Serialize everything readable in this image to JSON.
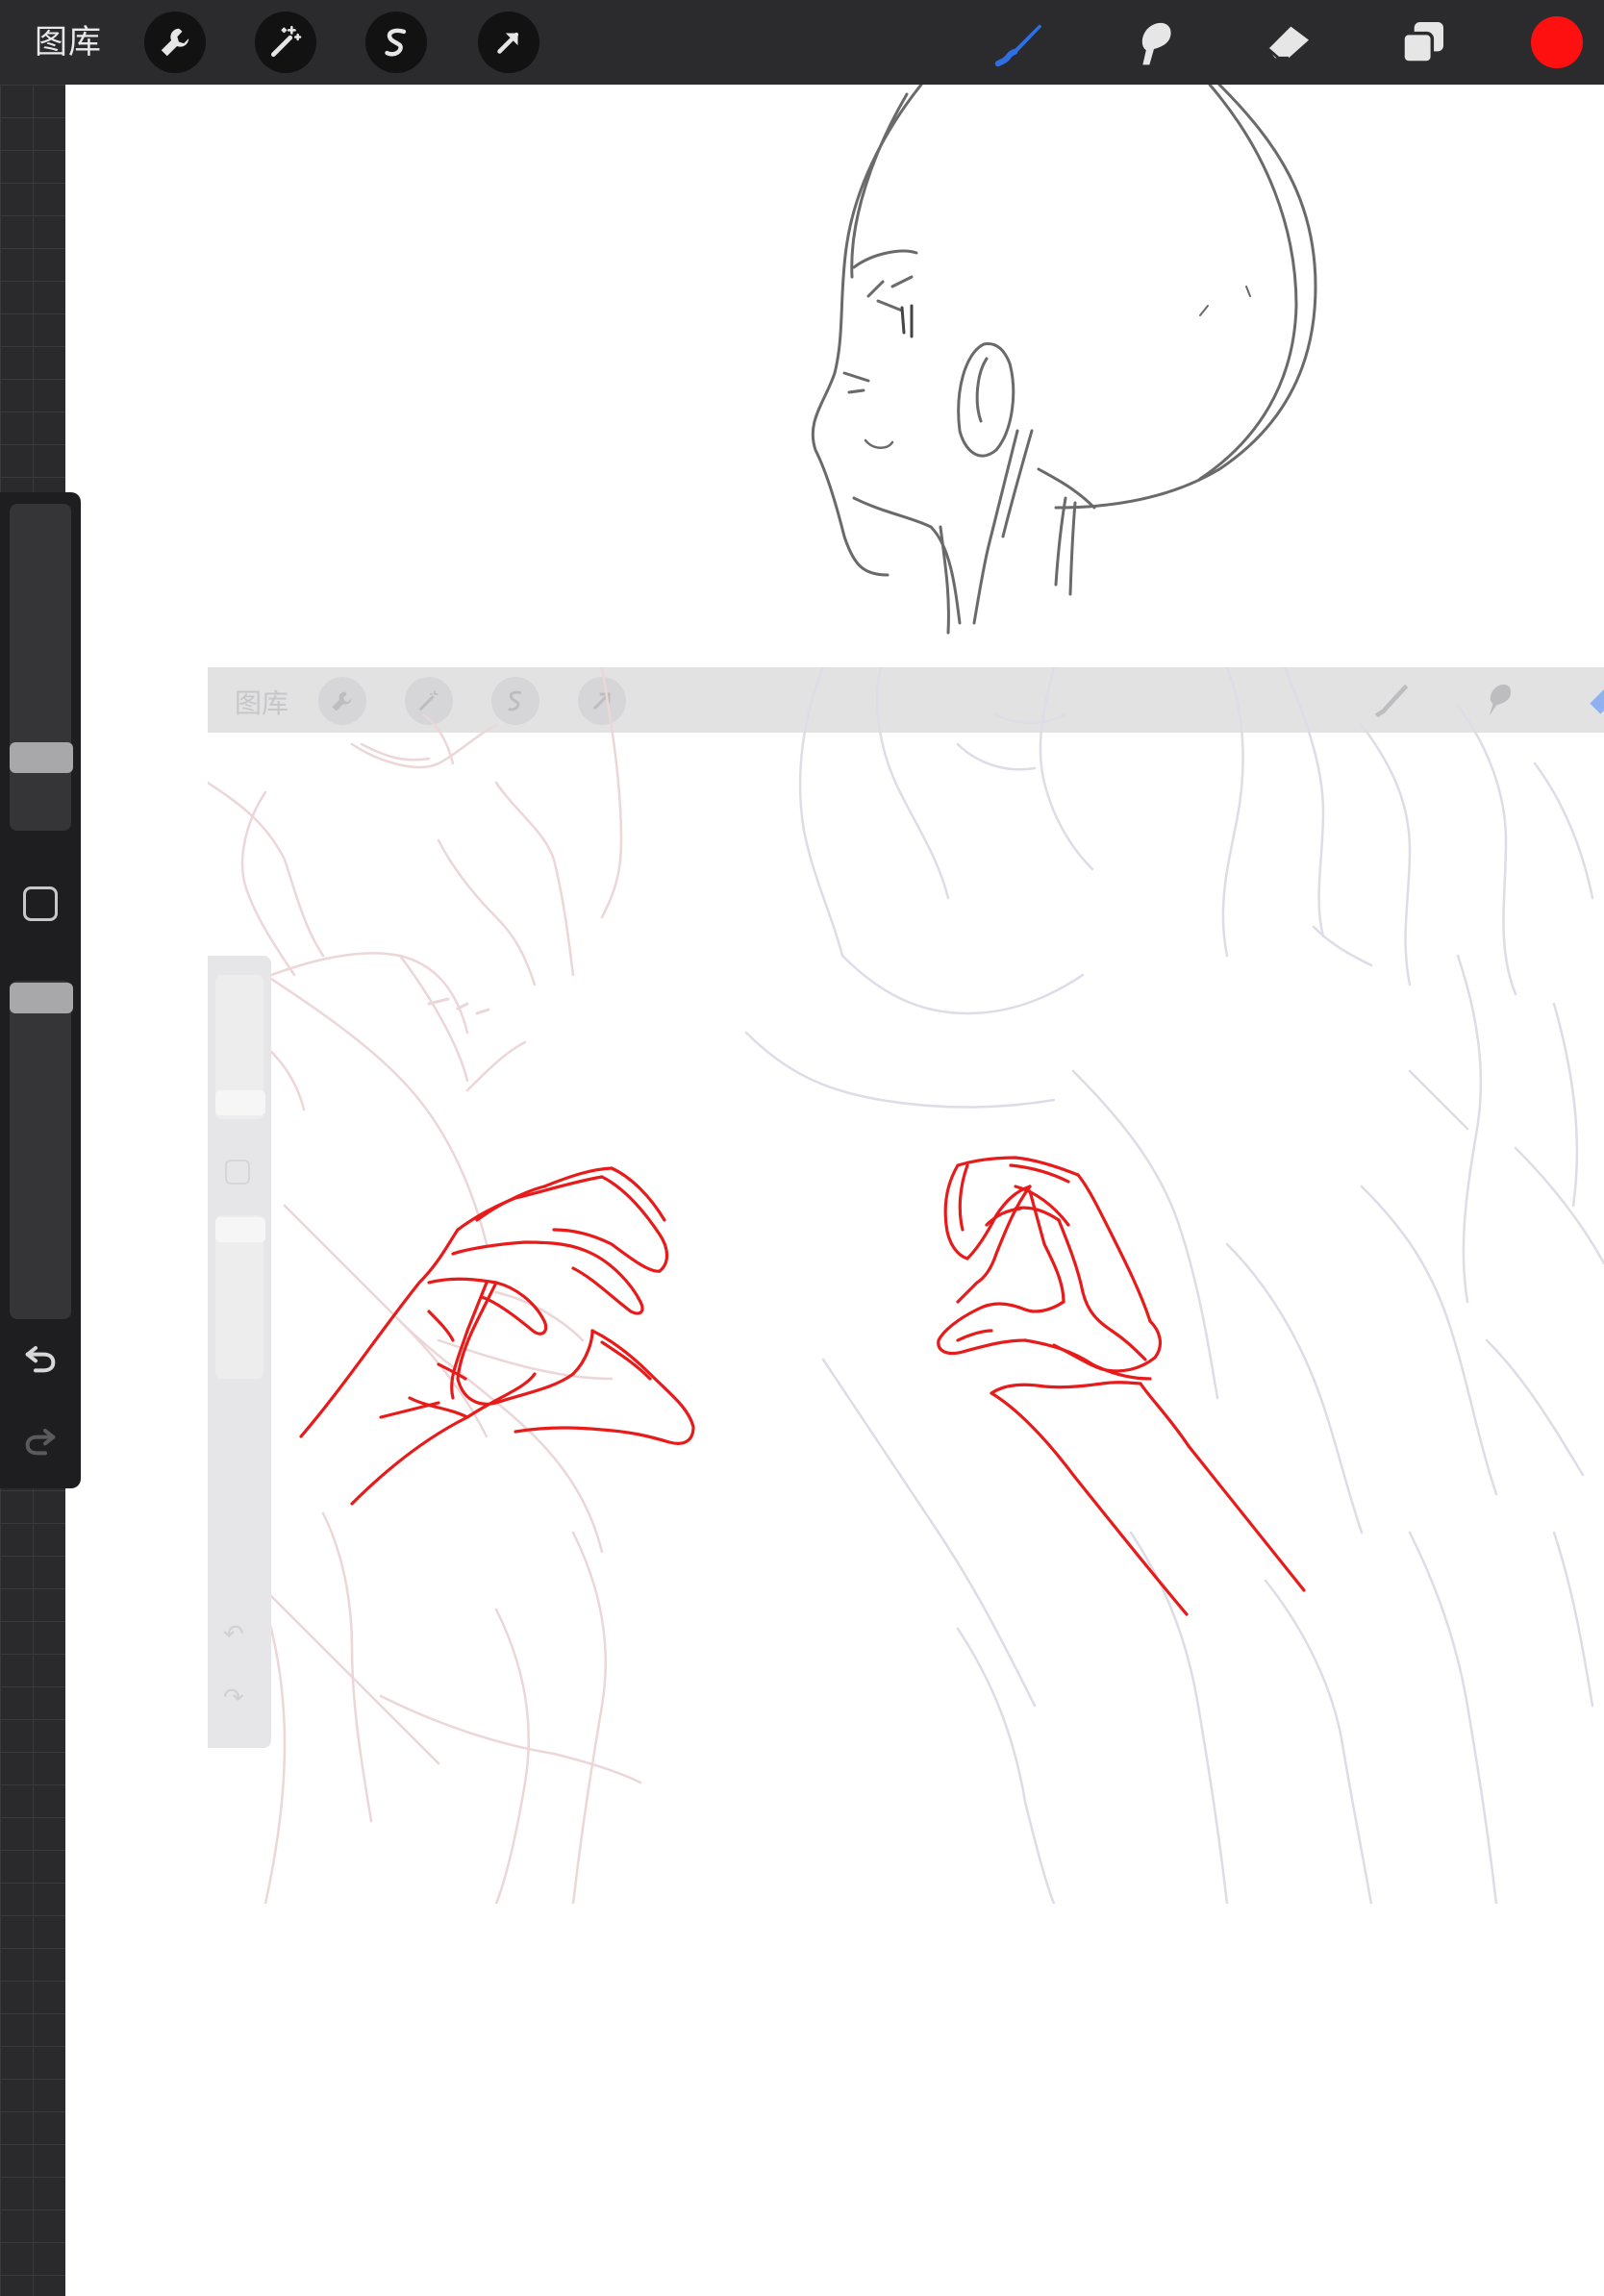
{
  "toolbar": {
    "gallery_label": "图库",
    "left_tools": [
      "wrench-icon",
      "magic-wand-icon",
      "selection-s-icon",
      "transform-arrow-icon"
    ],
    "right_tools": [
      "brush-icon",
      "smudge-icon",
      "eraser-icon",
      "layers-icon"
    ],
    "active_tool": "brush-icon",
    "active_color": "#ff1010",
    "brush_active_color": "#2f6fe4"
  },
  "side_panel": {
    "tools": [
      "brush-size-slider",
      "modify-button",
      "opacity-slider",
      "undo-icon",
      "redo-icon"
    ]
  },
  "reference_screenshot": {
    "gallery_label": "图库",
    "stroke_color_red": "#e81b1b"
  }
}
